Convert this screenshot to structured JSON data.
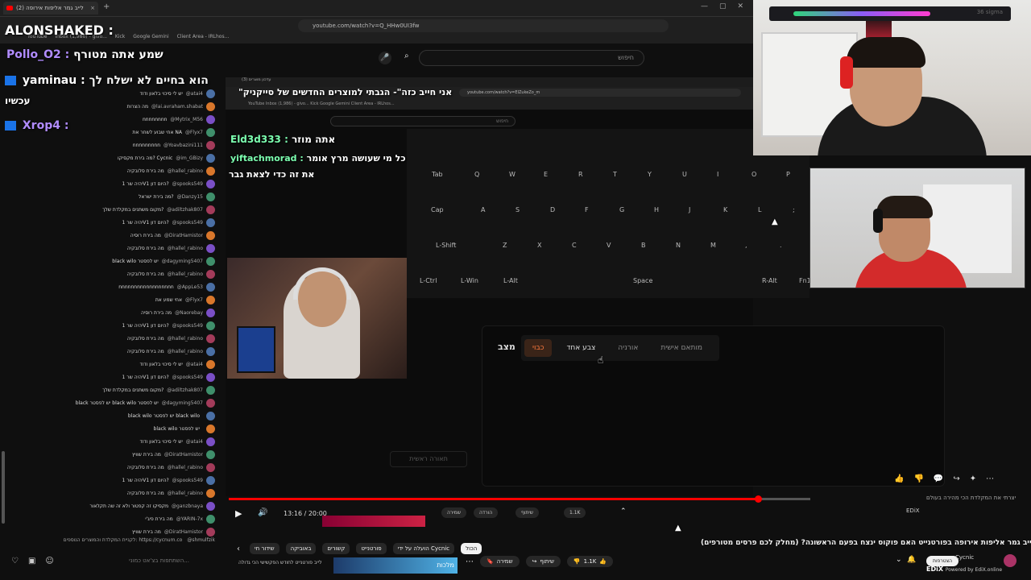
{
  "browser": {
    "tab_title": "לייב גמר אליפות אירופה (2)",
    "url": "youtube.com/watch?v=Q_HHw0UI3fw",
    "bookmarks": [
      "YouTube",
      "Inbox (1,986) - givo...",
      "Kick",
      "Google Gemini",
      "Client Area - IRLhos..."
    ]
  },
  "yt_search": {
    "placeholder": "חיפוש"
  },
  "overlay_chat": {
    "msg1": "ALONSHAKED :",
    "msg2_name": "Pollo_O2 :",
    "msg2_text": "שמע אתה מטורף",
    "msg3_name": "yaminau :",
    "msg3_text": "הוא בחיים לא ישלח לך",
    "msg4_text": "עכשיו",
    "msg5_name": "Xrop4 :",
    "nested1_name": "Eld3d333 :",
    "nested1_text": "אתה מוזר",
    "nested2_name": "yiftachmorad :",
    "nested2_text": "כל מי שעושה מרץ אומר",
    "nested3_text": "את זה כדי לצאת גבר"
  },
  "chat_rows": [
    {
      "msg": "יש לי סיכוי בלאון ודוד",
      "name": "@atai4"
    },
    {
      "msg": "מה הצרות",
      "name": "@lai.avraham.shabat"
    },
    {
      "msg": "nnnnnnnn",
      "name": "@Mytrix_M56"
    },
    {
      "msg": "אחי שבוע לשחר את NA",
      "name": "@Flyx7"
    },
    {
      "msg": "nnnnnnnnn",
      "name": "@Yoavbazini111"
    },
    {
      "msg": "מה בירת מקסיקו? Cycnic",
      "name": "@im_GBizy"
    },
    {
      "msg": "מה בירת סלובקיה",
      "name": "@hallel_rabino"
    },
    {
      "msg": "יהיה שר 1V1 היום דון?",
      "name": "@spooks549"
    },
    {
      "msg": "מה בירת ישראל?",
      "name": "@Danzy15"
    },
    {
      "msg": "מקום משתנים במקלדת שלך?",
      "name": "@adiltzhak807"
    },
    {
      "msg": "יהיה שר 1V1 היום דון?",
      "name": "@spooks549"
    },
    {
      "msg": "מה בירת רוסיה",
      "name": "@DiratHamistor"
    },
    {
      "msg": "מה בירת סלובקיה",
      "name": "@hallel_rabino"
    },
    {
      "msg": "black wilo יש לפסטר",
      "name": "@dagyming5407"
    },
    {
      "msg": "מה בירת סלובקיה",
      "name": "@hallel_rabino"
    },
    {
      "msg": "nnnnnnnnnnnnnnnnnn",
      "name": "@AppLe53"
    },
    {
      "msg": "אחי שמע את",
      "name": "@Flyx7"
    },
    {
      "msg": "מה בירת רוסיה",
      "name": "@Naorebay"
    },
    {
      "msg": "יהיה שר 1V1 היום דון?",
      "name": "@spooks549"
    },
    {
      "msg": "מה בירת סלובקיה",
      "name": "@hallel_rabino"
    },
    {
      "msg": "מה בירת סלובקיה",
      "name": "@hallel_rabino"
    },
    {
      "msg": "יש לי סיכוי בלאון ודוד",
      "name": "@atai4"
    },
    {
      "msg": "יהיה שר 1V1 היום דון?",
      "name": "@spooks549"
    },
    {
      "msg": "מקום משתנים במקלדת שלך?",
      "name": "@adiltzhak807"
    },
    {
      "msg": "black יש לפסטר black wilo יש לפסטר",
      "name": "@dagyming5407"
    },
    {
      "msg": "black wilo יש לפסטר black wilo",
      "name": ""
    },
    {
      "msg": "black wilo יש לפסטר",
      "name": ""
    },
    {
      "msg": "יש לי סיכוי בלאון ודוד",
      "name": "@atai4"
    },
    {
      "msg": "מה בירת שוויץ",
      "name": "@DiratHamistor"
    },
    {
      "msg": "מה בירת סלובקיה",
      "name": "@hallel_rabino"
    },
    {
      "msg": "יהיה שר 1V1 היום דון?",
      "name": "@spooks549"
    },
    {
      "msg": "מה בירת סלובקיה",
      "name": "@hallel_rabino"
    },
    {
      "msg": "מקסיקו זה קפטור ולא זה שה תקלאור",
      "name": "@ganzbnaya"
    },
    {
      "msg": "מה בירת פיג'י",
      "name": "@YARIN-7x"
    },
    {
      "msg": "מה בירת שוויץ",
      "name": "@DiratHamistor"
    }
  ],
  "chat_footer": {
    "text": "לקניית המקלדת והמוצרים הנוספים: https://cycnum.co",
    "name": "@shmulfzik"
  },
  "chat_input": {
    "placeholder": "השתתפות בצ'אט כמוני..."
  },
  "nested": {
    "tab": "עדכון מוצרים (3)",
    "url": "youtube.com/watch?v=EIZukeZo_m",
    "bookmarks": "YouTube  Inbox (1,986) - givo...  Kick  Google Gemini  Client Area - IRLhos...",
    "title": "\"אני חייב כזה\"- הגבתי למוצרים החדשים של סייקניק",
    "search_placeholder": "חיפוש"
  },
  "keyboard": {
    "row1": [
      "Tab",
      "Q",
      "W",
      "E",
      "R",
      "T",
      "Y",
      "U",
      "I",
      "O",
      "P"
    ],
    "row2": [
      "Cap",
      "A",
      "S",
      "D",
      "F",
      "G",
      "H",
      "J",
      "K",
      "L",
      ";"
    ],
    "row3": [
      "L-Shift",
      "Z",
      "X",
      "C",
      "V",
      "B",
      "N",
      "M",
      ",",
      "."
    ],
    "row4": [
      "L-Ctrl",
      "L-Win",
      "L-Alt",
      "Space",
      "R-Alt",
      "Fn1"
    ]
  },
  "settings": {
    "mode_label": "מצב",
    "options": [
      "כבוי",
      "צבע אחד",
      "אורניה",
      "מותאם אישית"
    ],
    "active_option": "כבוי",
    "back_button": "תאורה ראשית"
  },
  "nested_player": {
    "time": "13:16 / 20:00",
    "progress": 0.91,
    "cta": "יצרתי את המקלדת הכי מהירה בעולם",
    "edix": "EDiX",
    "like_count": "1.1K",
    "share": "שיתוף",
    "save": "שמירה",
    "download": "הורדה"
  },
  "alert": {
    "label": "36 sigma"
  },
  "main": {
    "title": "לייב גמר אליפות אירופה בפורטנייט האם פוקוס ינצח בפעם הראשונה? (מחלק לכם פרסים מטורפים)",
    "chips": [
      "הכול",
      "הועלה על ידי Cycnic",
      "פורטנייט",
      "קשורים",
      "באוביקה",
      "שידור חי"
    ],
    "like_count": "1.1K",
    "share_label": "שיתוף",
    "save_label": "שמירה",
    "channel": "Cycnic",
    "subscribed": "הצטרפות",
    "edix": "EDiX",
    "edix_sub": "Powered by EdiX.online",
    "rec_title": "מלכות",
    "rec_text": "לייב פורטנייט לחודש הפקשישי הכי גדולה"
  }
}
